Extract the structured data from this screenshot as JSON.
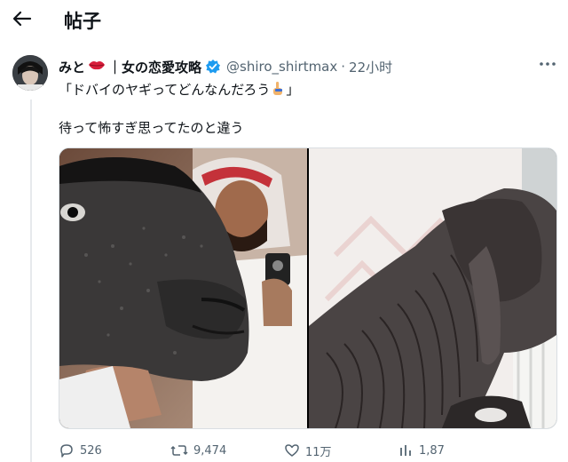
{
  "header": {
    "title": "帖子",
    "back_icon": "arrow-left-icon"
  },
  "tweet": {
    "display_name": "みと",
    "display_name_suffix": "｜女の恋愛攻略",
    "handle": "@shiro_shirtmax",
    "separator": "·",
    "time": "22小时",
    "text_line1": "「ドバイのヤギってどんなんだろう",
    "text_line1_end": "」",
    "text_line2": "待って怖すぎ思ってたのと違う",
    "emoji_name": "pointing-hand-icon"
  },
  "actions": {
    "reply_count": "526",
    "retweet_count": "9,474",
    "like_count": "11万",
    "views_count": "1,87"
  },
  "colors": {
    "text": "#0f1419",
    "muted": "#536471",
    "verified": "#1d9bf0",
    "lips": "#d81e3b"
  }
}
